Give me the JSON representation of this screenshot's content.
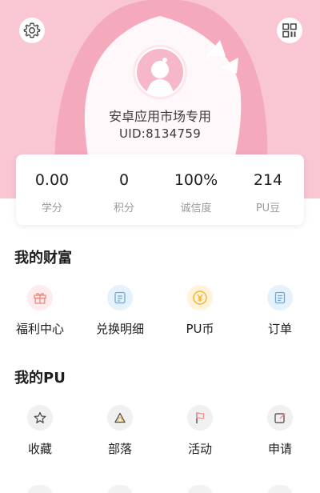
{
  "profile": {
    "username": "安卓应用市场专用",
    "uid": "UID:8134759"
  },
  "stats": [
    {
      "value": "0.00",
      "label": "学分"
    },
    {
      "value": "0",
      "label": "积分"
    },
    {
      "value": "100%",
      "label": "诚信度"
    },
    {
      "value": "214",
      "label": "PU豆"
    }
  ],
  "wealth": {
    "title": "我的财富",
    "items": [
      {
        "label": "福利中心",
        "icon": "gift-icon"
      },
      {
        "label": "兑换明细",
        "icon": "list-icon"
      },
      {
        "label": "PU币",
        "icon": "yen-coin-icon"
      },
      {
        "label": "订单",
        "icon": "document-icon"
      }
    ]
  },
  "pu": {
    "title": "我的PU",
    "items": [
      {
        "label": "收藏",
        "icon": "star-icon"
      },
      {
        "label": "部落",
        "icon": "tribe-icon"
      },
      {
        "label": "活动",
        "icon": "flag-icon"
      },
      {
        "label": "申请",
        "icon": "edit-icon"
      }
    ]
  },
  "colors": {
    "header_bg": "#f9c6d4",
    "accent_pink": "#f08a8a",
    "accent_blue": "#6fa8d8",
    "accent_yellow": "#f2b233"
  }
}
